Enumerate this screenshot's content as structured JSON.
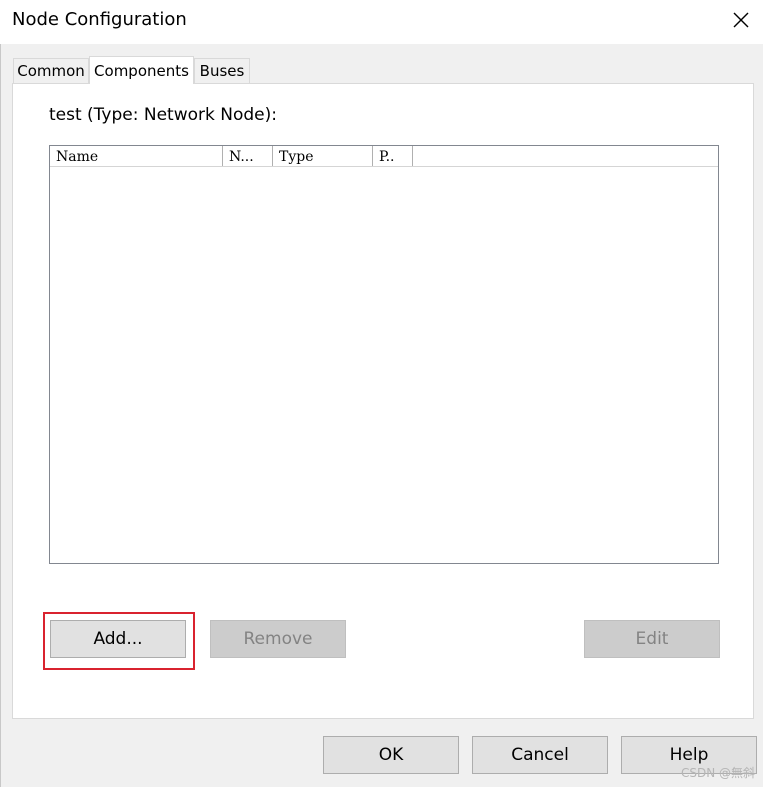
{
  "window": {
    "title": "Node Configuration",
    "close_icon": "close-icon"
  },
  "tabs": [
    {
      "label": "Common",
      "active": false
    },
    {
      "label": "Components",
      "active": true
    },
    {
      "label": "Buses",
      "active": false
    }
  ],
  "main": {
    "node_label": "test (Type: Network Node):",
    "columns": [
      "Name",
      "N...",
      "Type",
      "P.."
    ],
    "rows": []
  },
  "buttons": {
    "add": "Add...",
    "remove": "Remove",
    "edit": "Edit",
    "ok": "OK",
    "cancel": "Cancel",
    "help": "Help"
  },
  "annotation": {
    "highlight_color": "#d9232f"
  },
  "watermark": "CSDN @無斜"
}
